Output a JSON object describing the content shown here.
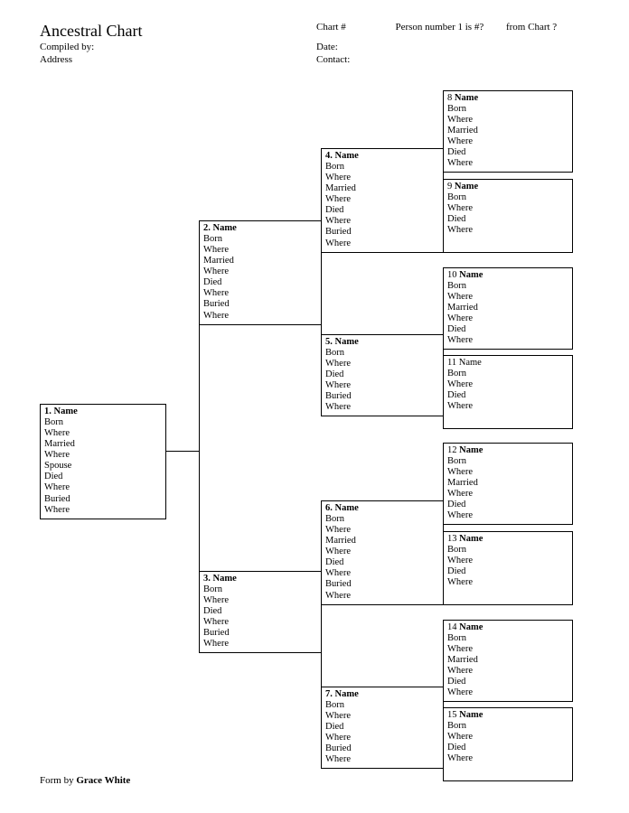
{
  "header": {
    "title": "Ancestral Chart",
    "compiled_by": "Compiled by:",
    "address": "Address",
    "chart_num": "Chart #",
    "person_note": "Person number 1 is #?",
    "from_chart": "from Chart ?",
    "date": "Date:",
    "contact": "Contact:"
  },
  "boxes": {
    "b1": {
      "head": "1. Name",
      "f": [
        "Born",
        "Where",
        "Married",
        "Where",
        "Spouse",
        "Died",
        "Where",
        "Buried",
        "Where"
      ]
    },
    "b2": {
      "head": "2. Name",
      "f": [
        "Born",
        "Where",
        "Married",
        "Where",
        "Died",
        "Where",
        "Buried",
        "Where"
      ]
    },
    "b3": {
      "head": "3. Name",
      "f": [
        "Born",
        "Where",
        "Died",
        "Where",
        "Buried",
        "Where"
      ]
    },
    "b4": {
      "head": "4. Name",
      "f": [
        "Born",
        "Where",
        "Married",
        "Where",
        "Died",
        "Where",
        "Buried",
        "Where"
      ]
    },
    "b5": {
      "head": "5. Name",
      "f": [
        "Born",
        "Where",
        "Died",
        "Where",
        "Buried",
        "Where"
      ]
    },
    "b6": {
      "head": "6. Name",
      "f": [
        "Born",
        "Where",
        "Married",
        "Where",
        "Died",
        "Where",
        "Buried",
        "Where"
      ]
    },
    "b7": {
      "head": "7. Name",
      "f": [
        "Born",
        "Where",
        "Died",
        "Where",
        "Buried",
        "Where"
      ]
    },
    "b8": {
      "head": "8 Name",
      "f": [
        "Born",
        "Where",
        "Married",
        "Where",
        "Died",
        "Where"
      ]
    },
    "b9": {
      "head": "9 Name",
      "f": [
        "Born",
        "Where",
        "Died",
        "Where"
      ]
    },
    "b10": {
      "head": "10 Name",
      "f": [
        "Born",
        "Where",
        "Married",
        "Where",
        "Died",
        "Where"
      ]
    },
    "b11": {
      "head": "11 Name",
      "f": [
        "Born",
        "Where",
        "Died",
        "Where"
      ]
    },
    "b12": {
      "head": "12 Name",
      "f": [
        "Born",
        "Where",
        "Married",
        "Where",
        "Died",
        "Where"
      ]
    },
    "b13": {
      "head": "13 Name",
      "f": [
        "Born",
        "Where",
        "Died",
        "Where"
      ]
    },
    "b14": {
      "head": "14 Name",
      "f": [
        "Born",
        "Where",
        "Married",
        "Where",
        "Died",
        "Where"
      ]
    },
    "b15": {
      "head": "15 Name",
      "f": [
        "Born",
        "Where",
        "Died",
        "Where"
      ]
    }
  },
  "footer": {
    "prefix": "Form by ",
    "author": "Grace White"
  }
}
